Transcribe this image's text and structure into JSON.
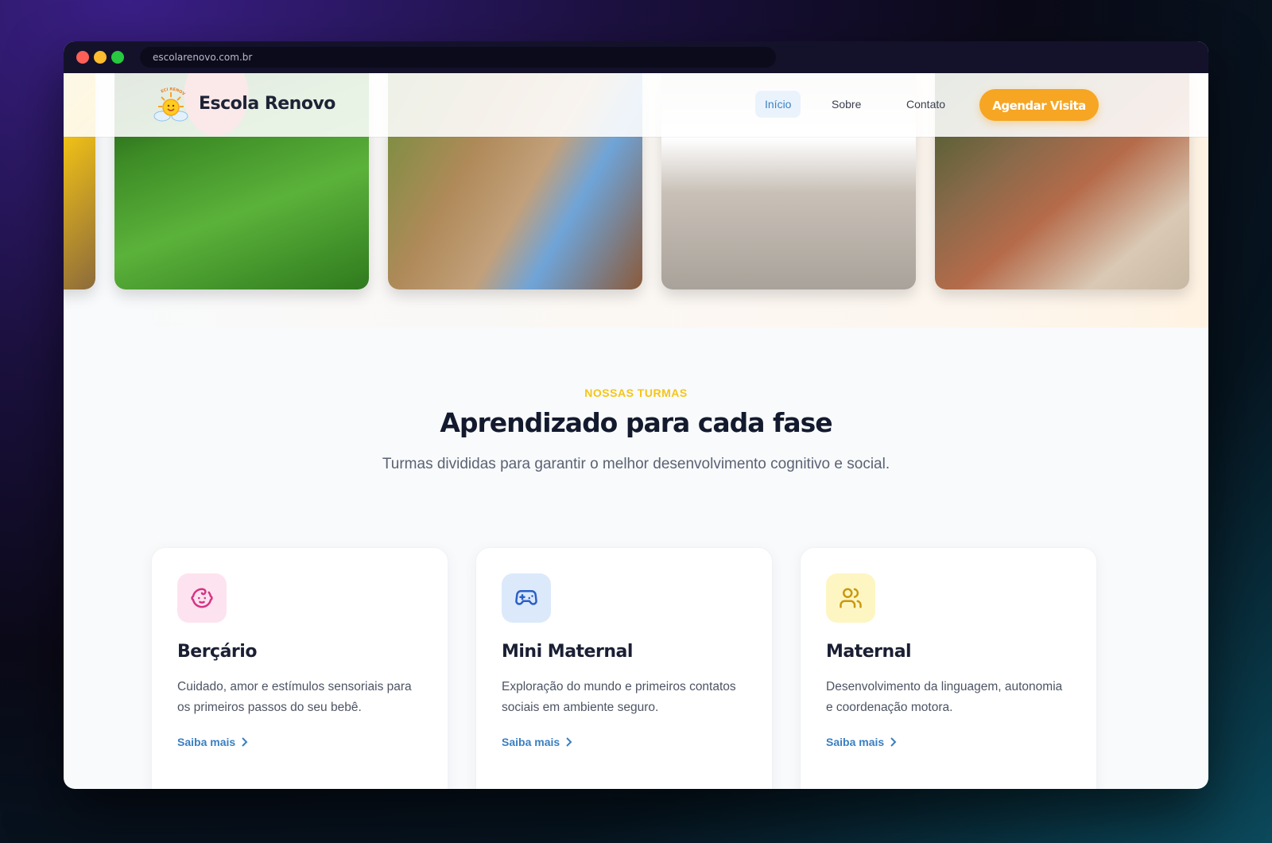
{
  "browser": {
    "url": "escolarenovo.com.br"
  },
  "navbar": {
    "brand": "Escola Renovo",
    "logo_text": "ECI RENOVO",
    "items": [
      {
        "label": "Início",
        "active": true
      },
      {
        "label": "Sobre",
        "active": false
      },
      {
        "label": "Contato",
        "active": false
      }
    ],
    "cta_label": "Agendar Visita",
    "accent": "#f6a623",
    "active_color": "#3b82c4"
  },
  "gallery": {
    "photos": [
      "soccer-ball-grass",
      "child-garden-plants",
      "children-karate-class",
      "children-planting-garden"
    ]
  },
  "section": {
    "eyebrow": "NOSSAS TURMAS",
    "title": "Aprendizado para cada fase",
    "subtitle": "Turmas divididas para garantir o melhor desenvolvimento cognitivo e social."
  },
  "cards": [
    {
      "icon": "baby-face-icon",
      "icon_color": "#d63384",
      "title": "Berçário",
      "text": "Cuidado, amor e estímulos sensoriais para os primeiros passos do seu bebê.",
      "link": "Saiba mais"
    },
    {
      "icon": "gamepad-icon",
      "icon_color": "#2b5fc7",
      "title": "Mini Maternal",
      "text": "Exploração do mundo e primeiros contatos sociais em ambiente seguro.",
      "link": "Saiba mais"
    },
    {
      "icon": "users-icon",
      "icon_color": "#c9980f",
      "title": "Maternal",
      "text": "Desenvolvimento da linguagem, autonomia e coordenação motora.",
      "link": "Saiba mais"
    }
  ]
}
